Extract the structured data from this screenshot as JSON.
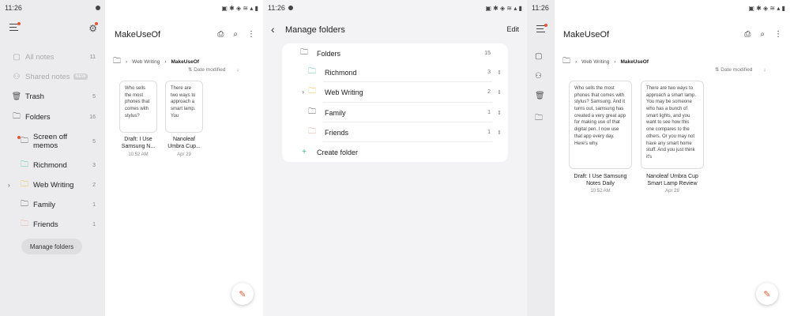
{
  "status_bar": {
    "time": "11:26"
  },
  "colors": {
    "accent": "#e4572e",
    "folder_richmond": "#57c7b0",
    "folder_web_writing": "#e6c14a",
    "folder_friends": "#e8a9a0",
    "create_plus": "#3db37a"
  },
  "screen1": {
    "drawer": {
      "items": [
        {
          "label": "All notes",
          "count": "11",
          "icon": "notes-icon"
        },
        {
          "label": "Shared notes",
          "badge": "NEW",
          "icon": "shared-icon"
        },
        {
          "label": "Trash",
          "count": "5",
          "icon": "trash-icon"
        },
        {
          "label": "Folders",
          "count": "16",
          "icon": "folder-icon"
        },
        {
          "label": "Screen off memos",
          "count": "5",
          "icon": "memo-folder-icon"
        },
        {
          "label": "Richmond",
          "count": "3",
          "icon": "folder-icon"
        },
        {
          "label": "Web Writing",
          "count": "2",
          "icon": "folder-icon"
        },
        {
          "label": "Family",
          "count": "1",
          "icon": "folder-icon"
        },
        {
          "label": "Friends",
          "count": "1",
          "icon": "folder-icon"
        }
      ],
      "manage_folders_label": "Manage folders"
    },
    "title": "MakeUseOf",
    "breadcrumb": {
      "parent": "Web Writing",
      "current": "MakeUseOf"
    },
    "sort_label": "Date modified",
    "cards": [
      {
        "preview": "Who sells the most phones that comes with stylus?",
        "title": "Draft: I Use Samsung N...",
        "date": "10:52 AM"
      },
      {
        "preview": "There are two ways to approach a smart lamp. You",
        "title": "Nanoleaf Umbra Cup...",
        "date": "Apr 29"
      }
    ]
  },
  "screen2": {
    "title": "Manage folders",
    "edit_label": "Edit",
    "rows": [
      {
        "label": "Folders",
        "count": "15"
      },
      {
        "label": "Richmond",
        "count": "3"
      },
      {
        "label": "Web Writing",
        "count": "2"
      },
      {
        "label": "Family",
        "count": "1"
      },
      {
        "label": "Friends",
        "count": "1"
      }
    ],
    "create_label": "Create folder"
  },
  "screen3": {
    "title": "MakeUseOf",
    "breadcrumb": {
      "parent": "Web Writing",
      "current": "MakeUseOf"
    },
    "sort_label": "Date modified",
    "cards": [
      {
        "preview": "Who sells the most phones that comes with stylus? Samsung. And it turns out, samsung has created a very great app for making use of that digital pen. I now use that app every day. Here's why.",
        "title": "Draft: I Use Samsung Notes Daily",
        "date": "10:52 AM"
      },
      {
        "preview": "There are two ways to approach a smart lamp. You may be someone who has a bunch of smart lights, and you want to see how this one compares to the others. Or you may not have any smart home stuff. And you just think it's",
        "title": "Nanoleaf Umbra Cup Smart Lamp Review",
        "date": "Apr 29"
      }
    ]
  }
}
